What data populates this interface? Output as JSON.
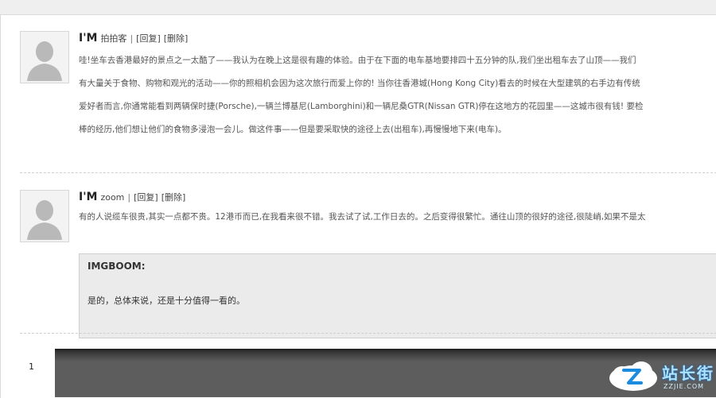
{
  "comments": [
    {
      "author": "I'M",
      "source": "拍拍客",
      "separator": "|",
      "reply_label": "[回复]",
      "delete_label": "[删除]",
      "lines": [
        "哇!坐车去香港最好的景点之一太酷了——我认为在晚上这是很有趣的体验。由于在下面的电车基地要排四十五分钟的队,我们坐出租车去了山顶——我们",
        "有大量关于食物、购物和观光的活动——你的照相机会因为这次旅行而爱上你的! 当你往香港城(Hong Kong City)看去的时候在大型建筑的右手边有传统",
        "爱好者而言,你通常能看到两辆保时捷(Porsche),一辆兰博基尼(Lamborghini)和一辆尼桑GTR(Nissan GTR)停在这地方的花园里——这城市很有钱! 要检",
        "棒的经历,他们想让他们的食物多浸泡一会儿。做这件事——但是要采取快的途径上去(出租车),再慢慢地下来(电车)。"
      ]
    },
    {
      "author": "I'M",
      "source": "zoom",
      "separator": "|",
      "reply_label": "[回复]",
      "delete_label": "[删除]",
      "lines": [
        "有的人说缆车很贵,其实一点都不贵。12港币而已,在我看来很不错。我去试了试,工作日去的。之后变得很繁忙。通往山顶的很好的途径,很陡峭,如果不是太"
      ],
      "quote": {
        "title": "IMGBOOM:",
        "text": "是的，总体来说，还是十分值得一看的。"
      }
    }
  ],
  "pager": {
    "current": "1"
  },
  "watermark": {
    "logo_text": "站长街",
    "sub_text": "ZZJIE.COM"
  },
  "colors": {
    "background": "#efefef",
    "panel": "#ffffff",
    "divider": "#cfcfcf",
    "quote_bg": "#ebebeb",
    "photo": "#5d5d5d"
  }
}
